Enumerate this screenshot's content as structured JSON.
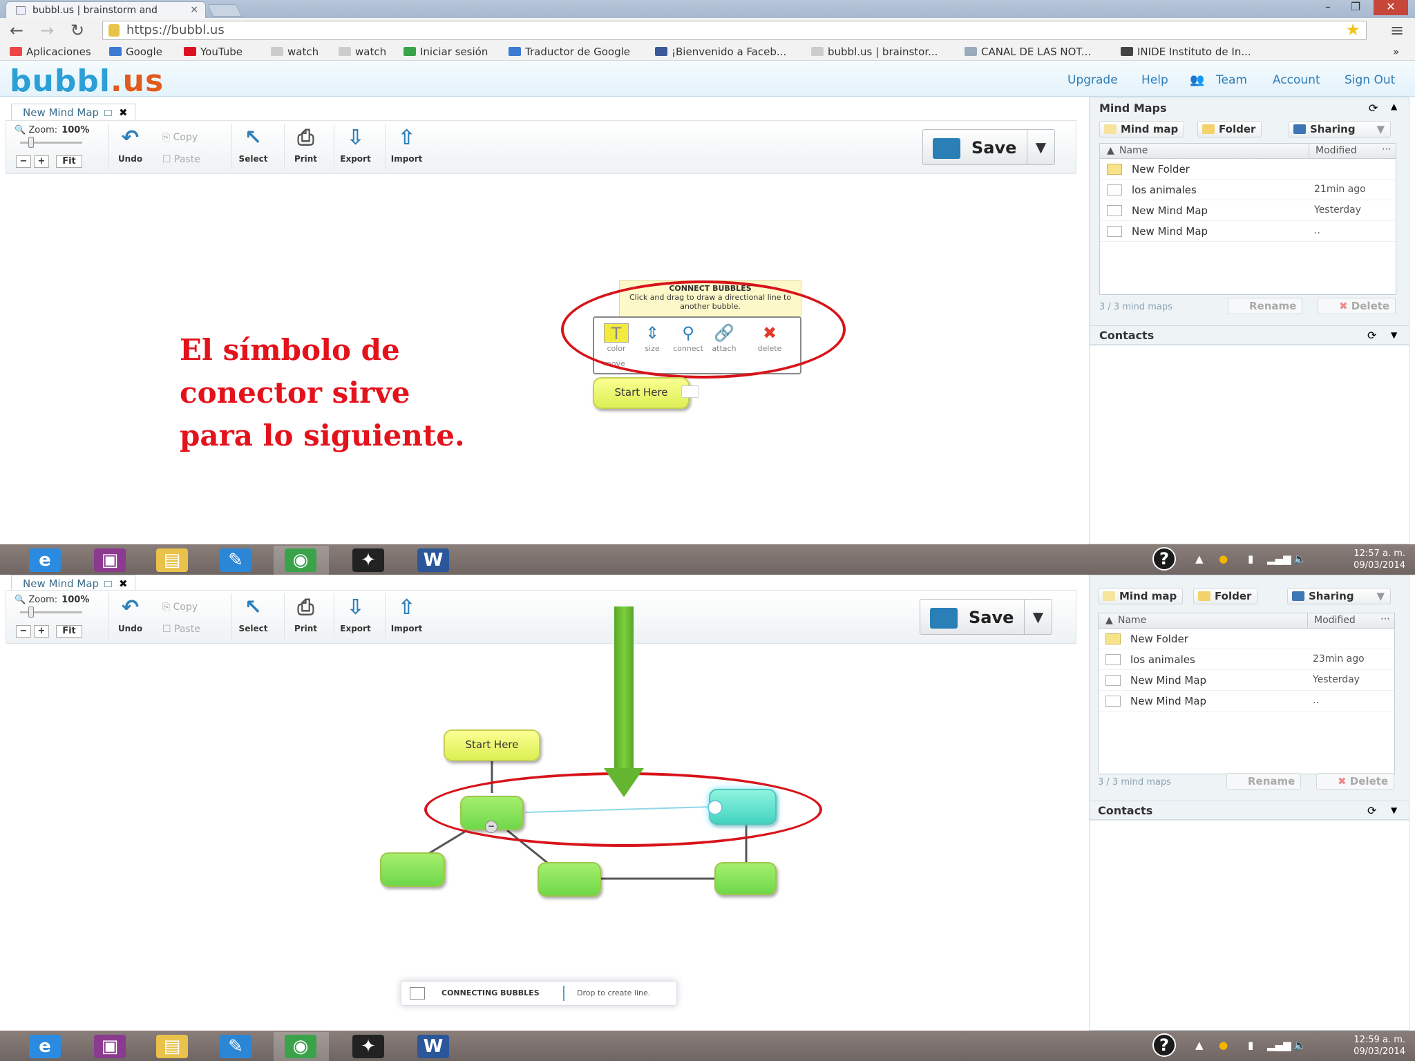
{
  "browser": {
    "tab_title": "bubbl.us | brainstorm and",
    "tab_close": "×",
    "url": "https://bubbl.us",
    "bookmarks": [
      "Aplicaciones",
      "Google",
      "YouTube",
      "watch",
      "watch",
      "Iniciar sesión",
      "Traductor de Google",
      "¡Bienvenido a Faceb...",
      "bubbl.us | brainstor...",
      "CANAL DE LAS NOT...",
      "INIDE Instituto de In..."
    ],
    "bookmark_colors": [
      "#e44",
      "#3b7bd4",
      "#d12",
      "#ccc",
      "#ccc",
      "#3aa34a",
      "#3b7bd4",
      "#3b5998",
      "#ccc",
      "#9ab",
      "#444"
    ]
  },
  "app": {
    "logo_main": "bubbl",
    "logo_tld": ".us",
    "links": [
      "Upgrade",
      "Help",
      "Team",
      "Account",
      "Sign Out"
    ]
  },
  "editor": {
    "doc_tab": "New Mind Map",
    "zoom_label": "Zoom:",
    "zoom_value": "100%",
    "zoom_buttons": [
      "−",
      "+",
      "Fit"
    ],
    "tools": [
      "Undo",
      "Select",
      "Print",
      "Export",
      "Import"
    ],
    "copy_label": "Copy",
    "paste_label": "Paste",
    "save_label": "Save"
  },
  "panel": {
    "title": "Mind Maps",
    "btn_mindmap": "Mind map",
    "btn_folder": "Folder",
    "btn_sharing": "Sharing",
    "col_name": "Name",
    "col_modified": "Modified",
    "files_top": [
      {
        "name": "New Folder",
        "modified": "",
        "folder": true
      },
      {
        "name": "los animales",
        "modified": "21min ago",
        "folder": false
      },
      {
        "name": "New Mind Map",
        "modified": "Yesterday",
        "folder": false
      },
      {
        "name": "New Mind Map",
        "modified": "..",
        "folder": false
      }
    ],
    "files_bottom": [
      {
        "name": "New Folder",
        "modified": "",
        "folder": true
      },
      {
        "name": "los animales",
        "modified": "23min ago",
        "folder": false
      },
      {
        "name": "New Mind Map",
        "modified": "Yesterday",
        "folder": false
      },
      {
        "name": "New Mind Map",
        "modified": "..",
        "folder": false
      }
    ],
    "count_text": "3 / 3 mind maps",
    "rename": "Rename",
    "delete": "Delete",
    "contacts": "Contacts"
  },
  "canvas": {
    "note": "El símbolo de\nconector sirve\npara lo siguiente.",
    "tooltip_title": "CONNECT BUBBLES",
    "tooltip_text": "Click and drag to draw a directional line to another bubble.",
    "bubble_tools": [
      "color",
      "size",
      "connect",
      "attach",
      "delete"
    ],
    "move_label": "move",
    "start_here": "Start Here",
    "status_title": "CONNECTING BUBBLES",
    "status_text": "Drop to create line."
  },
  "taskbar": {
    "clock_top": "12:57 a. m.",
    "date_top": "09/03/2014",
    "clock_bottom": "12:59 a. m.",
    "date_bottom": "09/03/2014",
    "word_label": "W",
    "help_label": "?"
  },
  "colors": {
    "accent": "#2b9fd6",
    "annotation_red": "#e3121b",
    "arrow_green": "#64b631"
  }
}
